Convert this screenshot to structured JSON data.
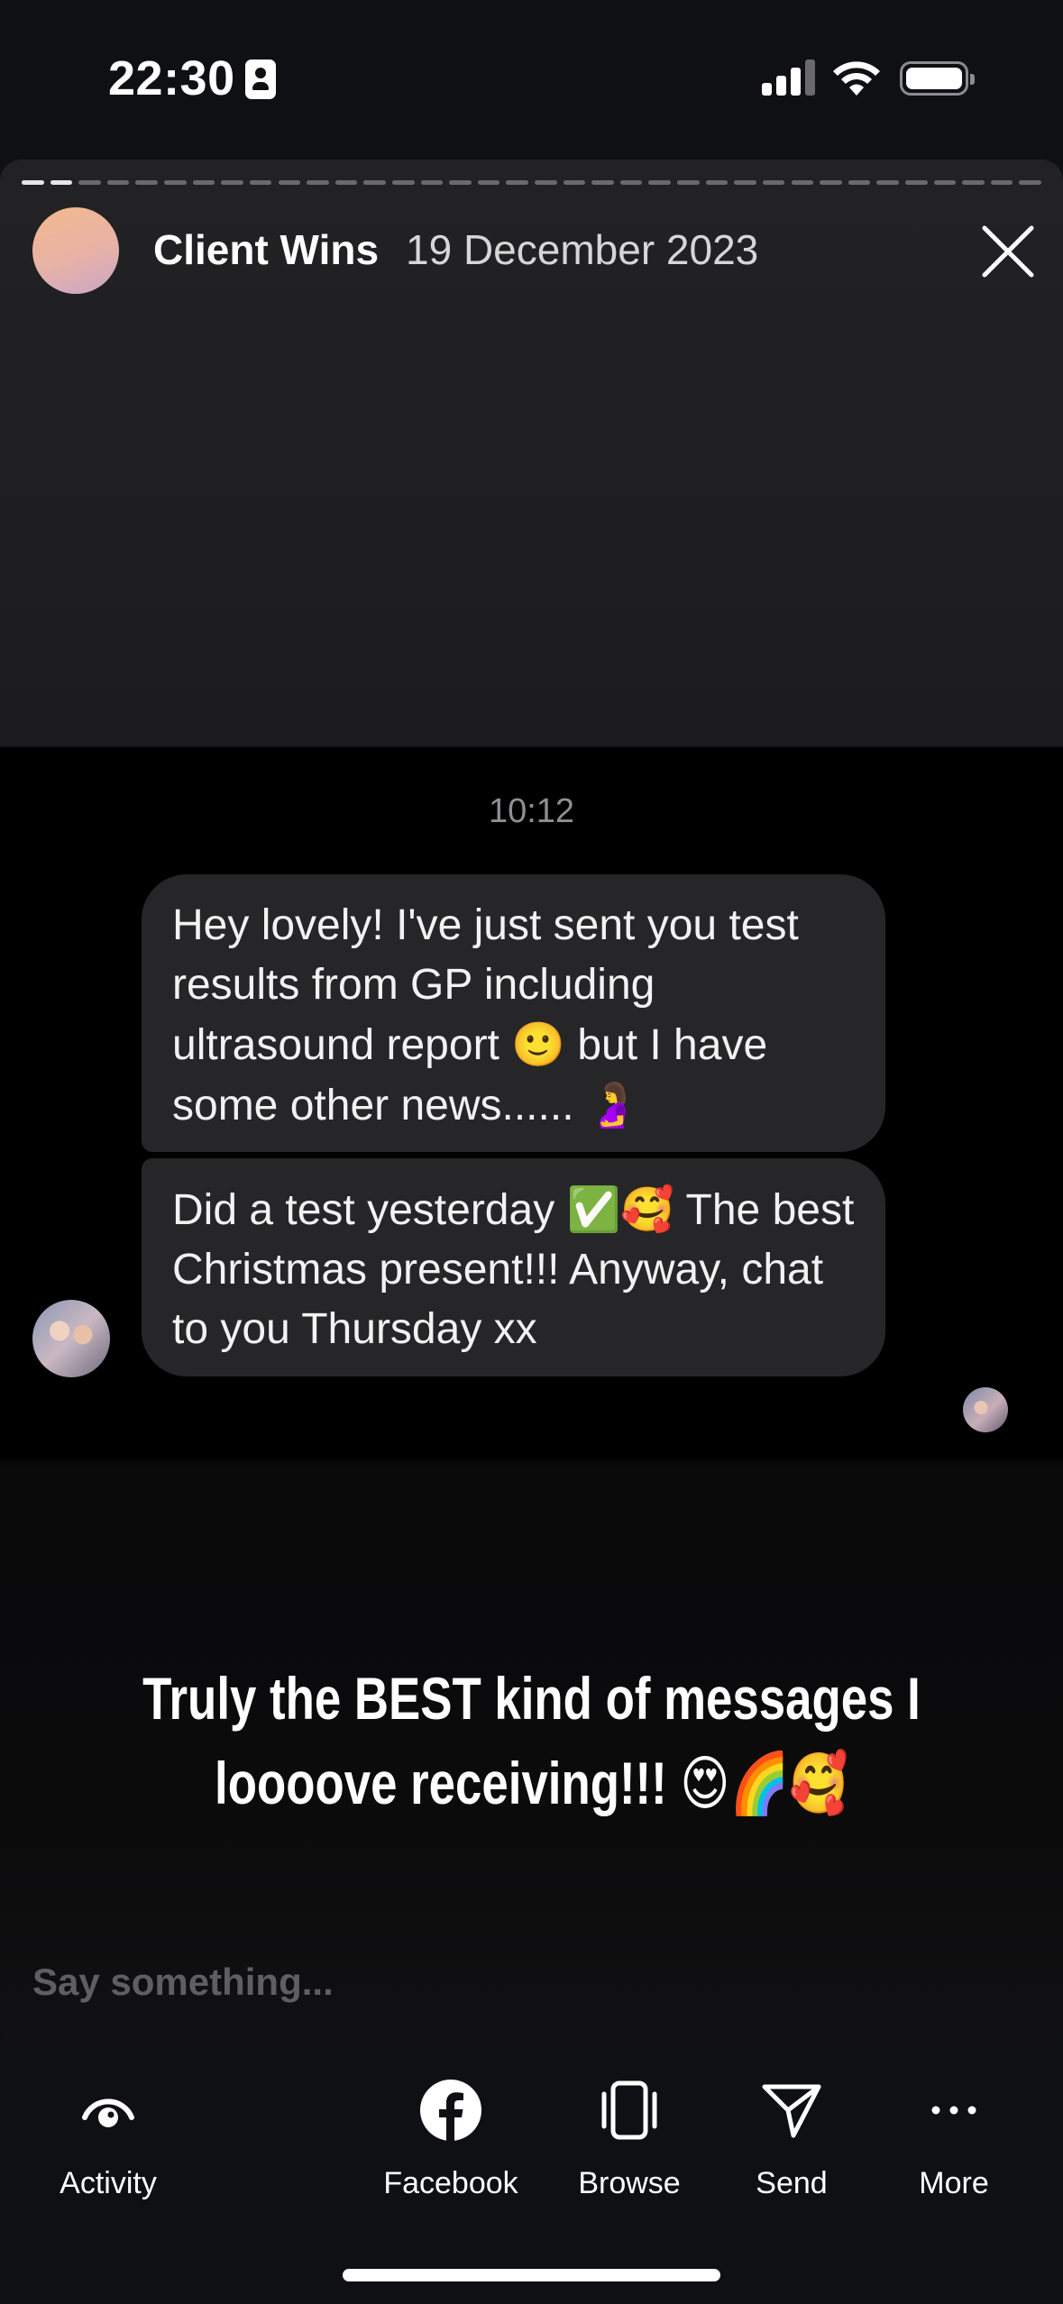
{
  "status_bar": {
    "time": "22:30"
  },
  "story": {
    "username": "Client Wins",
    "date": "19 December 2023",
    "progress": {
      "segments": 36,
      "current_segment": 2
    },
    "chat": {
      "time": "10:12",
      "message1_text": "Hey lovely! I've just sent you test results from GP including ultrasound report ",
      "message1_emoji1": "🙂",
      "message1_text2": " but I have some other news...... ",
      "message1_emoji2": "🤰",
      "message2_text": "Did a test yesterday ",
      "message2_emoji": "✅🥰",
      "message2_text2": " The best Christmas present!!! Anyway, chat to you Thursday xx"
    },
    "caption_line1": "Truly the BEST kind of messages I",
    "caption_line2": "loooove receiving!!! ",
    "caption_emoji": "😍🌈🥰",
    "reply_placeholder": "Say something..."
  },
  "bottom_bar": {
    "activity_label": "Activity",
    "facebook_label": "Facebook",
    "browse_label": "Browse",
    "send_label": "Send",
    "more_label": "More"
  }
}
